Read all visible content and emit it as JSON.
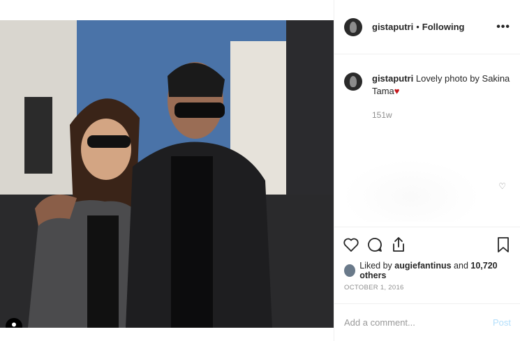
{
  "post": {
    "username": "gistaputri",
    "separator": "•",
    "follow_status": "Following",
    "more_label": "•••",
    "caption_text": "Lovely photo by Sakina Tama",
    "caption_emoji": "♥",
    "time_ago": "151w",
    "likes_prefix": "Liked by",
    "likes_user": "augiefantinus",
    "likes_and": "and",
    "likes_count": "10,720 others",
    "date": "OCTOBER 1, 2016",
    "comment_placeholder": "Add a comment...",
    "post_label": "Post"
  },
  "icons": {
    "heart": "heart-icon",
    "comment": "comment-icon",
    "share": "share-icon",
    "save": "bookmark-icon",
    "tag": "user-tag-icon"
  },
  "colors": {
    "text": "#262626",
    "muted": "#8e8e8e",
    "divider": "#efefef",
    "post_disabled": "#b2dffc",
    "emoji_heart": "#c4161c"
  }
}
